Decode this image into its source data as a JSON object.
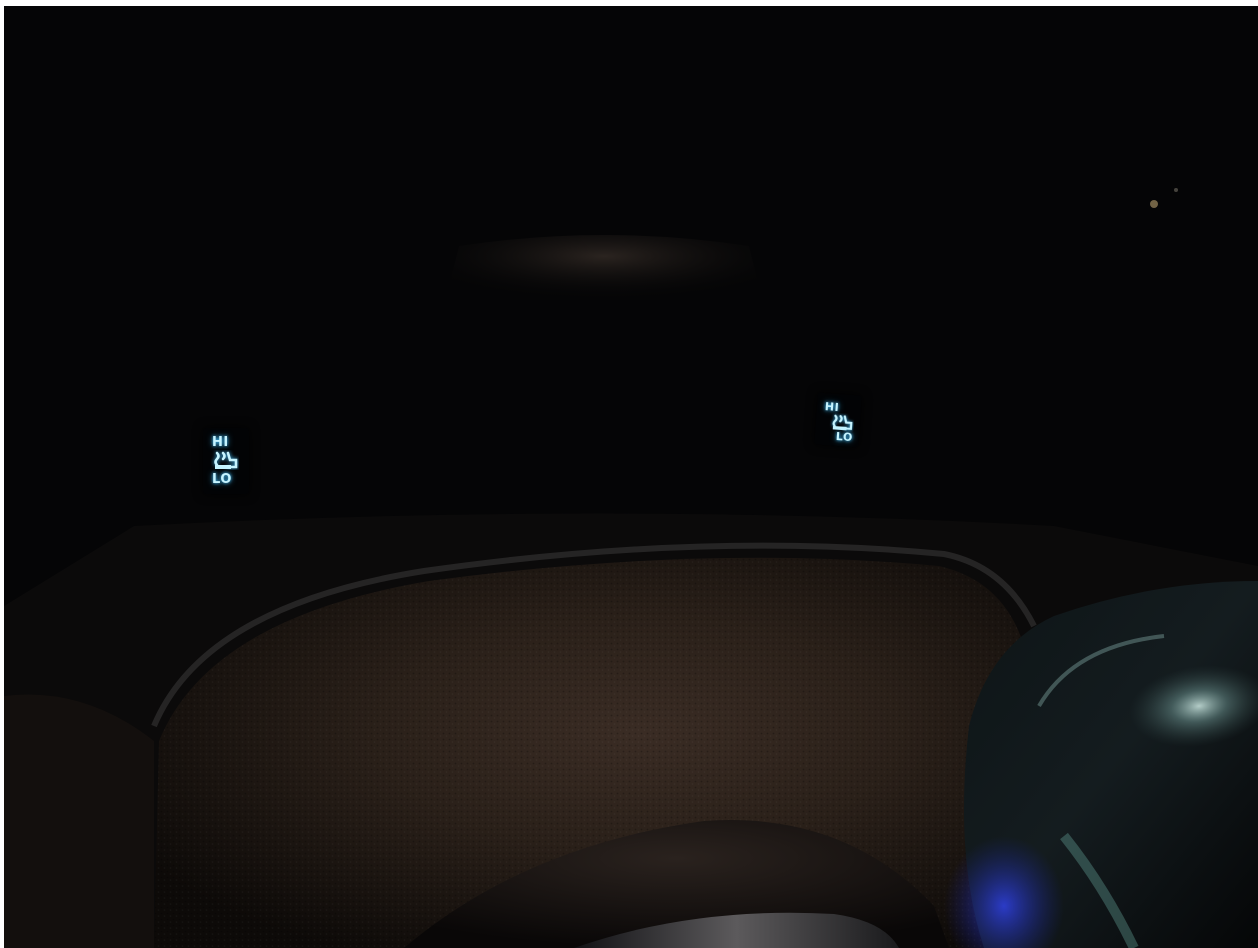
{
  "scene": {
    "colors": {
      "background": "#050506",
      "leather": "#2a211c",
      "indicator_glow": "#47c3ff",
      "indicator_text": "#c6f4ff",
      "shifter_highlight": "#bfe2df",
      "ambient_blue": "#2a3bd8"
    }
  },
  "left_seat_heater": {
    "hi_label": "HI",
    "lo_label": "LO",
    "icon": "heated-seat-icon"
  },
  "right_seat_heater": {
    "hi_label": "HI",
    "lo_label": "LO",
    "icon": "heated-seat-icon"
  }
}
